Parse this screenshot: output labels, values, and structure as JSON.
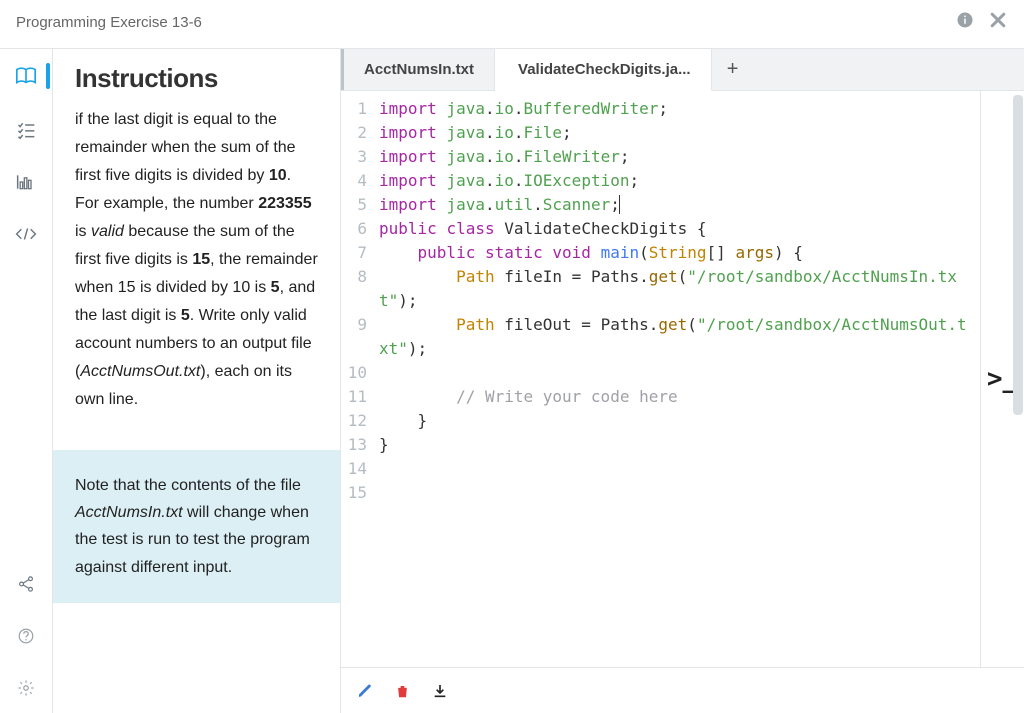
{
  "titlebar": {
    "title": "Programming Exercise 13-6"
  },
  "rail": {
    "items": [
      "book",
      "checklist",
      "chart",
      "code"
    ],
    "bottom": [
      "share",
      "help",
      "settings"
    ]
  },
  "instructions": {
    "heading": "Instructions",
    "body_html": "if the last digit is equal to the remainder when the sum of the first five digits is divided by <b>10</b>. For example, the number <b>223355</b> is <i>valid</i> because the sum of the first five digits is <b>15</b>, the remainder when 15 is divided by 10 is <b>5</b>, and the last digit is <b>5</b>. Write only valid account numbers to an output file (<i>AcctNumsOut.txt</i>), each on its own line.",
    "note_html": "Note that the contents of the file <i>AcctNumsIn.txt</i> will change when the test is run to test the program against different input."
  },
  "tabs": {
    "items": [
      {
        "label": "AcctNumsIn.txt",
        "active": false
      },
      {
        "label": "ValidateCheckDigits.ja...",
        "active": true
      }
    ]
  },
  "code": {
    "lines": [
      {
        "n": 1,
        "html": "<span class='tok-kw'>import</span> <span class='tok-pkg'>java</span>.<span class='tok-pkg'>io</span>.<span class='tok-pkg'>BufferedWriter</span>;"
      },
      {
        "n": 2,
        "html": "<span class='tok-kw'>import</span> <span class='tok-pkg'>java</span>.<span class='tok-pkg'>io</span>.<span class='tok-pkg'>File</span>;"
      },
      {
        "n": 3,
        "html": "<span class='tok-kw'>import</span> <span class='tok-pkg'>java</span>.<span class='tok-pkg'>io</span>.<span class='tok-pkg'>FileWriter</span>;"
      },
      {
        "n": 4,
        "html": "<span class='tok-kw'>import</span> <span class='tok-pkg'>java</span>.<span class='tok-pkg'>io</span>.<span class='tok-pkg'>IOException</span>;"
      },
      {
        "n": 5,
        "html": "<span class='tok-kw'>import</span> <span class='tok-pkg'>java</span>.<span class='tok-pkg'>util</span>.<span class='tok-pkg'>Scanner</span>;<span class='cursor'></span>"
      },
      {
        "n": 6,
        "html": "<span class='tok-kw'>public</span> <span class='tok-kw'>class</span> <span class='tok-cls'>ValidateCheckDigits</span> {"
      },
      {
        "n": 7,
        "html": "    <span class='tok-kw'>public</span> <span class='tok-kw'>static</span> <span class='tok-kw'>void</span> <span class='tok-fn'>main</span>(<span class='tok-type'>String</span>[] <span class='tok-name'>args</span>) {"
      },
      {
        "n": 8,
        "html": "        <span class='tok-type'>Path</span> <span class='tok-plain'>fileIn</span> = <span class='tok-plain'>Paths</span>.<span class='tok-name'>get</span>(<span class='tok-str'>\"/root/sandbox/AcctNumsIn.txt\"</span>);"
      },
      {
        "n": 9,
        "html": "        <span class='tok-type'>Path</span> <span class='tok-plain'>fileOut</span> = <span class='tok-plain'>Paths</span>.<span class='tok-name'>get</span>(<span class='tok-str'>\"/root/sandbox/AcctNumsOut.txt\"</span>);"
      },
      {
        "n": 10,
        "html": ""
      },
      {
        "n": 11,
        "html": "        <span class='tok-cm'>// Write your code here</span>"
      },
      {
        "n": 12,
        "html": "    }"
      },
      {
        "n": 13,
        "html": "}"
      },
      {
        "n": 14,
        "html": ""
      },
      {
        "n": 15,
        "html": ""
      }
    ]
  },
  "terminal_prompt": ">_"
}
